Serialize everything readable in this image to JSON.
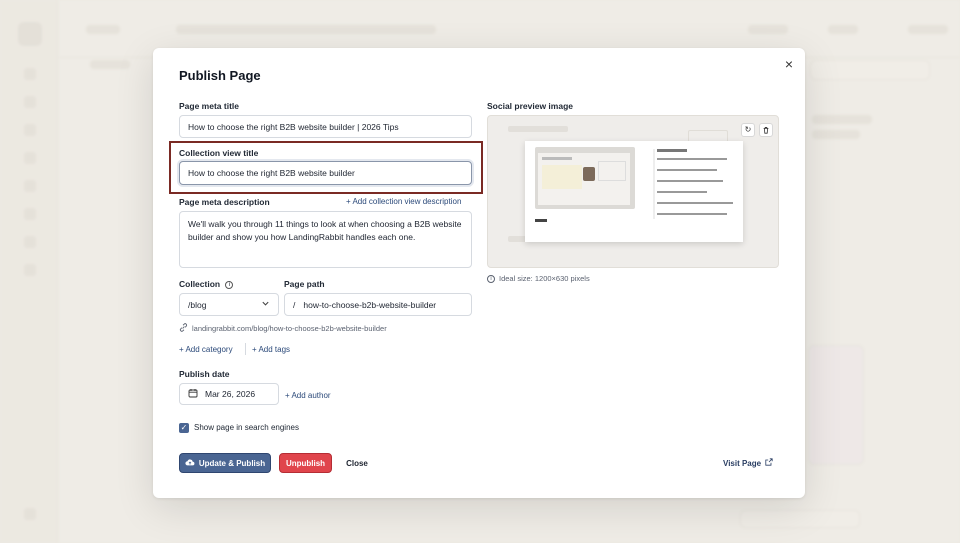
{
  "modal": {
    "title": "Publish Page",
    "close_label": "×"
  },
  "fields": {
    "meta_title": {
      "label": "Page meta title",
      "value": "How to choose the right B2B website builder | 2026 Tips"
    },
    "collection_view_title": {
      "label": "Collection view title",
      "value": "How to choose the right B2B website builder"
    },
    "meta_description": {
      "label": "Page meta description",
      "value": "We'll walk you through 11 things to look at when choosing a B2B website builder and show you how LandingRabbit handles each one.",
      "add_link": "+ Add collection view description"
    },
    "collection": {
      "label": "Collection",
      "value": "/blog"
    },
    "page_path": {
      "label": "Page path",
      "prefix": "/",
      "value": "how-to-choose-b2b-website-builder"
    },
    "url": "landingrabbit.com/blog/how-to-choose-b2b-website-builder",
    "add_category": "+ Add category",
    "add_tags": "+ Add tags",
    "publish_date": {
      "label": "Publish date",
      "value": "Mar 26, 2026"
    },
    "add_author": "+ Add author",
    "show_in_search": {
      "label": "Show page in search engines",
      "checked": true
    }
  },
  "preview": {
    "label": "Social preview image",
    "hint": "Ideal size: 1200×630 pixels"
  },
  "actions": {
    "update_publish": "Update & Publish",
    "unpublish": "Unpublish",
    "close": "Close",
    "visit_page": "Visit Page"
  },
  "colors": {
    "primary": "#4a6592",
    "danger": "#e0454c",
    "link": "#2c4a7a",
    "highlight": "#7a2a24"
  }
}
